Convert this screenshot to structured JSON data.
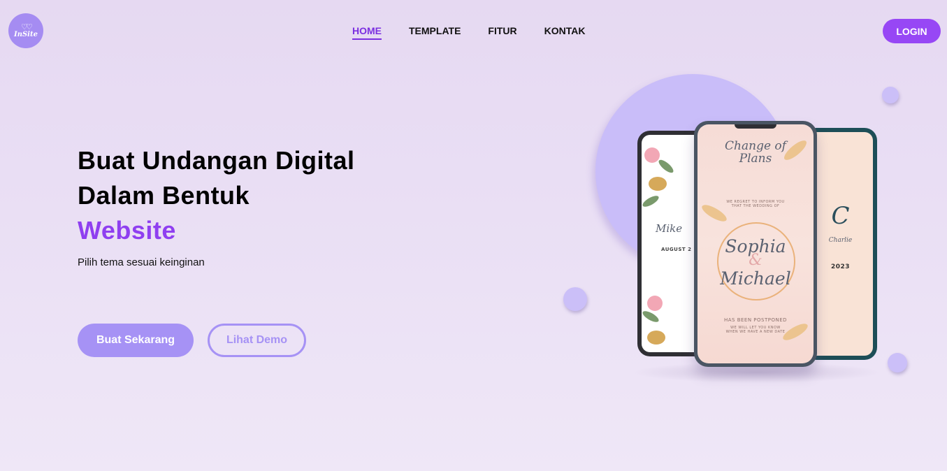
{
  "logo": {
    "icon": "hearts-icon",
    "text": "InSite"
  },
  "nav": {
    "items": [
      {
        "label": "HOME",
        "active": true
      },
      {
        "label": "TEMPLATE",
        "active": false
      },
      {
        "label": "FITUR",
        "active": false
      },
      {
        "label": "KONTAK",
        "active": false
      }
    ],
    "login_label": "LOGIN"
  },
  "hero": {
    "title_line1": "Buat Undangan Digital",
    "title_line2": "Dalam Bentuk",
    "title_accent": "Website",
    "subtitle": "Pilih tema sesuai keinginan",
    "primary_button": "Buat Sekarang",
    "secondary_button": "Lihat Demo"
  },
  "mockup": {
    "center": {
      "heading": "Change of Plans",
      "notice": "WE REGRET TO INFORM YOU THAT THE WEDDING OF",
      "name1": "Sophia",
      "amp": "&",
      "name2": "Michael",
      "postponed": "HAS BEEN POSTPONED",
      "footer": "WE WILL LET YOU KNOW WHEN WE HAVE A NEW DATE"
    },
    "left": {
      "name": "Mike",
      "date": "AUGUST 2"
    },
    "right": {
      "monogram": "C",
      "name": "Charlie",
      "year": "2023"
    }
  },
  "colors": {
    "accent": "#8f3ff0",
    "login": "#9747f5",
    "button": "#a692f5",
    "circle": "#c9bdf9"
  }
}
